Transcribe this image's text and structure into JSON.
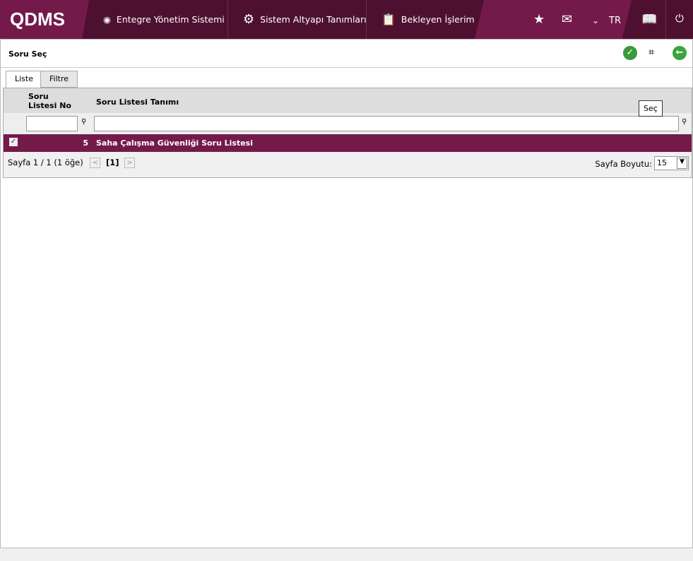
{
  "header": {
    "logo": "QDMS",
    "nav": [
      "Entegre Yönetim Sistemi",
      "Sistem Altyapı Tanımları",
      "Bekleyen İşlerim"
    ],
    "language": "TR"
  },
  "page": {
    "title": "Soru Seç",
    "tooltip": "Seç",
    "tabs": [
      "Liste",
      "Filtre"
    ]
  },
  "grid": {
    "columns": [
      "Soru Listesi No",
      "Soru Listesi Tanımı"
    ],
    "rows": [
      {
        "no": "5",
        "name": "Saha Çalışma Güvenliği Soru Listesi",
        "checked": true
      }
    ],
    "pager": {
      "info": "Sayfa 1 / 1 (1 öğe)",
      "current": "[1]",
      "size_label": "Sayfa Boyutu:",
      "size": "15"
    }
  }
}
